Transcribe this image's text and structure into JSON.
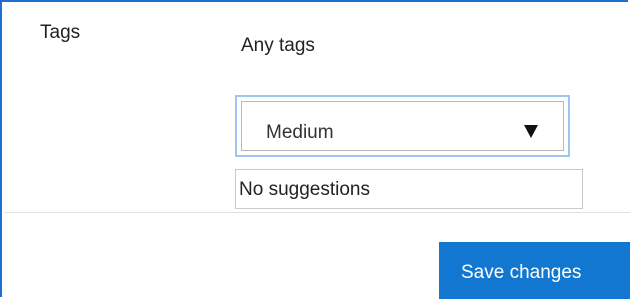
{
  "form": {
    "tags_label": "Tags",
    "any_tags_text": "Any tags",
    "select": {
      "selected_value": "Medium"
    },
    "suggestions_text": "No suggestions",
    "save_label": "Save changes"
  },
  "colors": {
    "frame_border": "#1f6fd1",
    "focus_ring": "#9ec6f3",
    "button_bg": "#1177d1",
    "button_text": "#ffffff"
  },
  "icons": {
    "select_arrow": "triangle-down-icon"
  }
}
